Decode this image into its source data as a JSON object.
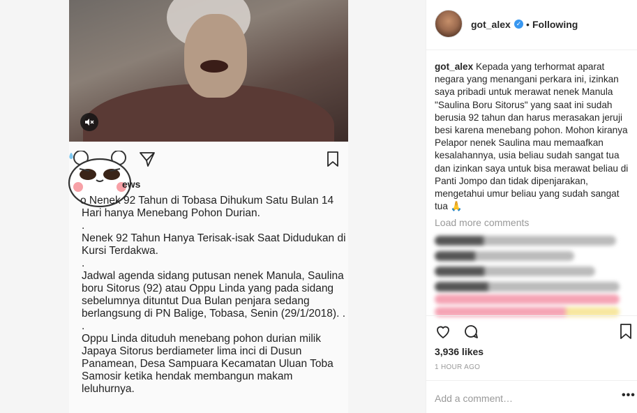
{
  "post": {
    "views_label": "ews",
    "paragraphs": [
      "o Nenek 92 Tahun di Tobasa Dihukum Satu Bulan 14 Hari hanya Menebang Pohon Durian.",
      ".",
      "Nenek 92 Tahun Hanya Terisak-isak Saat Didudukan di Kursi Terdakwa.",
      ".",
      "Jadwal agenda sidang putusan nenek Manula, Saulina boru Sitorus (92) atau Oppu Linda yang pada sidang sebelumnya dituntut Dua Bulan penjara sedang berlangsung di PN Balige, Tobasa, Senin (29/1/2018). .",
      ".",
      "Oppu Linda dituduh menebang pohon durian milik Japaya Sitorus berdiameter lima inci di Dusun Panamean, Desa Sampuara Kecamatan Uluan Toba Samosir ketika hendak membangun makam leluhurnya."
    ]
  },
  "header": {
    "username": "got_alex",
    "separator": "•",
    "follow_status": "Following"
  },
  "caption": {
    "author": "got_alex",
    "text": "Kepada yang terhormat aparat negara yang menangani perkara ini, izinkan saya pribadi untuk merawat nenek Manula \"Saulina Boru Sitorus\" yang saat ini sudah berusia 92 tahun dan harus merasakan jeruji besi karena menebang pohon. Mohon kiranya Pelapor nenek Saulina mau memaafkan kesalahannya, usia beliau sudah sangat tua dan izinkan saya untuk bisa merawat beliau di Panti Jompo dan tidak dipenjarakan, mengetahui umur beliau yang sudah sangat tua 🙏"
  },
  "comments": {
    "load_more": "Load more comments"
  },
  "stats": {
    "likes": "3,936 likes",
    "time": "1 HOUR AGO"
  },
  "comment_box": {
    "placeholder": "Add a comment…",
    "more": "•••"
  },
  "colors": {
    "verified": "#3897f0",
    "muted_text": "#999999",
    "highlight_pink": "#f5a3b4",
    "highlight_yellow": "#f7e7a0"
  }
}
